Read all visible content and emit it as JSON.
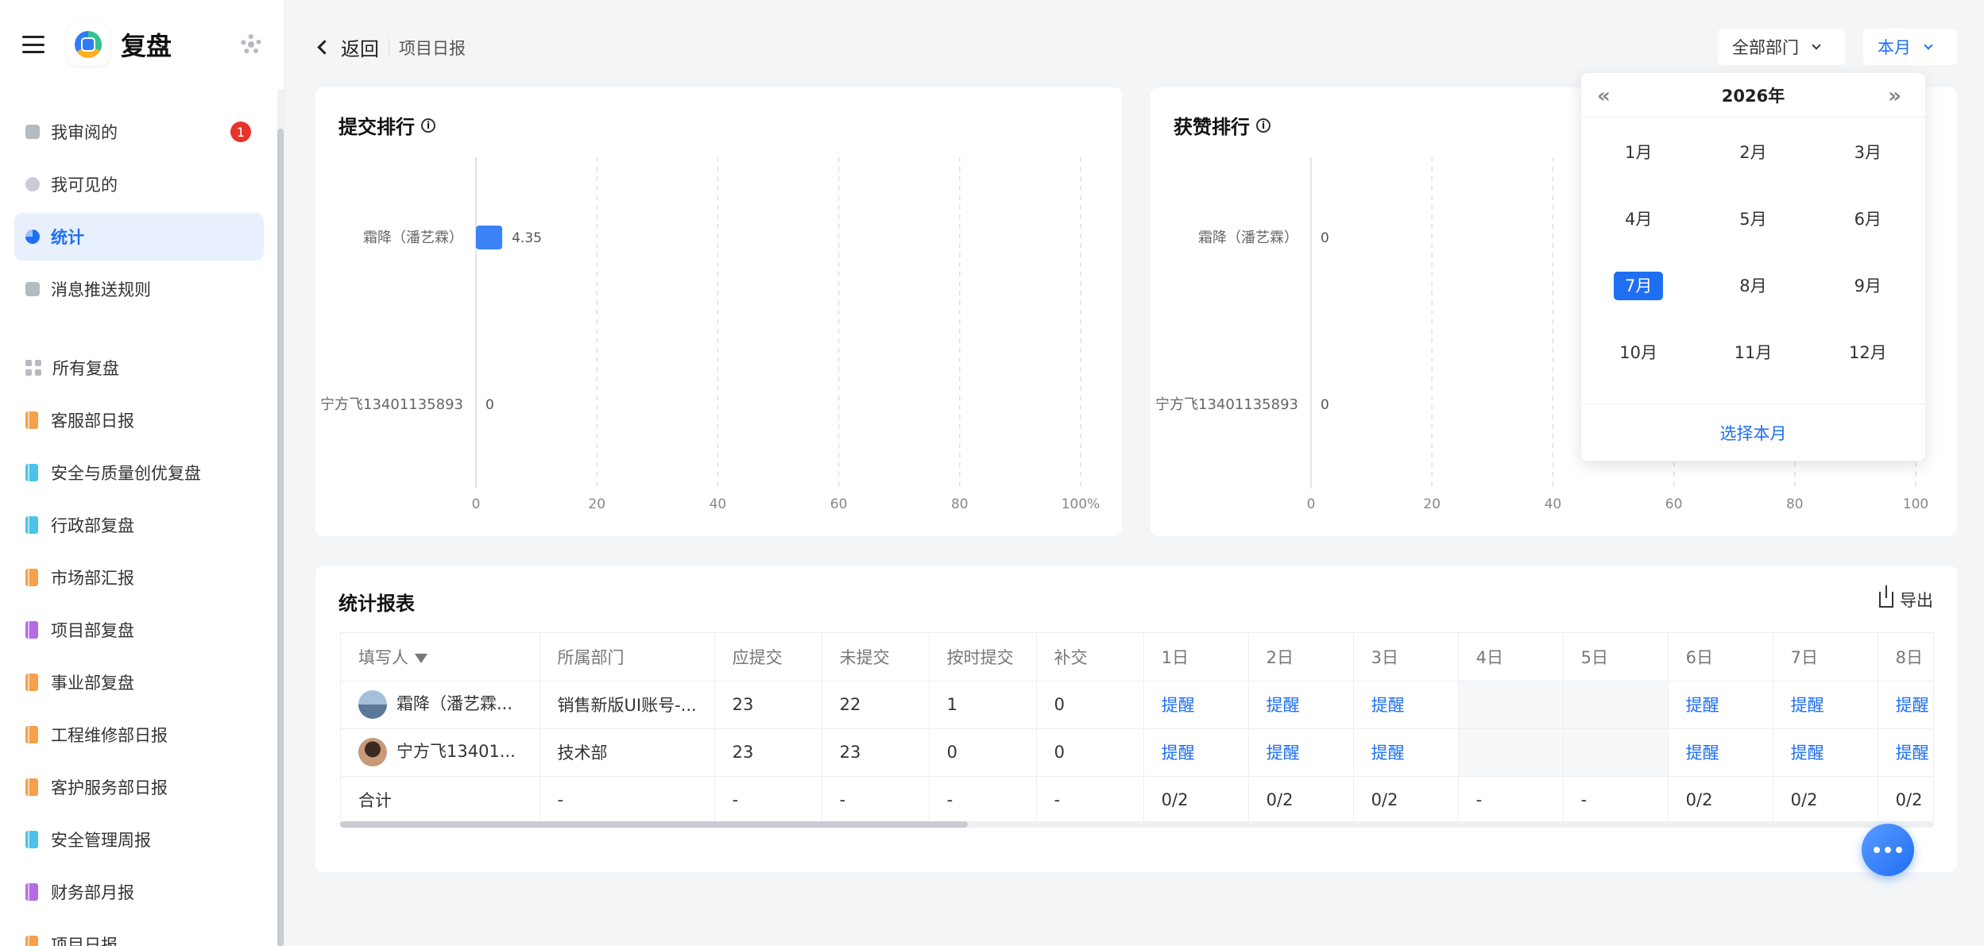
{
  "app": {
    "name": "复盘"
  },
  "sidebar": {
    "nav": [
      {
        "label": "我审阅的",
        "badge": "1"
      },
      {
        "label": "我可见的"
      },
      {
        "label": "统计"
      },
      {
        "label": "消息推送规则"
      }
    ],
    "groups_title": "所有复盘",
    "groups": [
      {
        "label": "客服部日报",
        "color": "orange"
      },
      {
        "label": "安全与质量创优复盘",
        "color": "cyan"
      },
      {
        "label": "行政部复盘",
        "color": "cyan"
      },
      {
        "label": "市场部汇报",
        "color": "orange"
      },
      {
        "label": "项目部复盘",
        "color": "purple"
      },
      {
        "label": "事业部复盘",
        "color": "orange"
      },
      {
        "label": "工程维修部日报",
        "color": "orange"
      },
      {
        "label": "客护服务部日报",
        "color": "orange"
      },
      {
        "label": "安全管理周报",
        "color": "cyan"
      },
      {
        "label": "财务部月报",
        "color": "purple"
      },
      {
        "label": "项目日报",
        "color": "orange"
      }
    ]
  },
  "header": {
    "back_label": "返回",
    "breadcrumb": "项目日报",
    "dept_filter": "全部部门",
    "period_filter": "本月"
  },
  "calendar": {
    "year": "2026年",
    "prev": "«",
    "next": "»",
    "months": [
      "1月",
      "2月",
      "3月",
      "4月",
      "5月",
      "6月",
      "7月",
      "8月",
      "9月",
      "10月",
      "11月",
      "12月"
    ],
    "selected": "7月",
    "footer": "选择本月"
  },
  "chart_data": [
    {
      "type": "bar",
      "title": "提交排行",
      "orientation": "horizontal",
      "categories": [
        "霜降（潘艺霖）",
        "宁方飞13401135893"
      ],
      "values": [
        4.35,
        0
      ],
      "value_labels": [
        "4.35",
        "0"
      ],
      "xlim": [
        0,
        100
      ],
      "xticks": [
        "0",
        "20",
        "40",
        "60",
        "80",
        "100%"
      ],
      "color": "#3b82f6",
      "grid": "vertical dashed"
    },
    {
      "type": "bar",
      "title": "获赞排行",
      "orientation": "horizontal",
      "categories": [
        "霜降（潘艺霖）",
        "宁方飞13401135893"
      ],
      "values": [
        0,
        0
      ],
      "value_labels": [
        "0",
        "0"
      ],
      "xlim": [
        0,
        100
      ],
      "xticks": [
        "0",
        "20",
        "40",
        "60",
        "80",
        "100"
      ],
      "color": "#3b82f6",
      "grid": "vertical dashed"
    }
  ],
  "report": {
    "title": "统计报表",
    "export": "导出",
    "columns": [
      "填写人",
      "所属部门",
      "应提交",
      "未提交",
      "按时提交",
      "补交",
      "1日",
      "2日",
      "3日",
      "4日",
      "5日",
      "6日",
      "7日",
      "8日"
    ],
    "rows": [
      {
        "name": "霜降（潘艺霖...",
        "dept": "销售新版UI账号-...",
        "should": "23",
        "missing": "22",
        "ontime": "1",
        "late": "0",
        "days": [
          "提醒",
          "提醒",
          "提醒",
          "",
          "",
          "提醒",
          "提醒",
          "提醒"
        ]
      },
      {
        "name": "宁方飞13401...",
        "dept": "技术部",
        "should": "23",
        "missing": "23",
        "ontime": "0",
        "late": "0",
        "days": [
          "提醒",
          "提醒",
          "提醒",
          "",
          "",
          "提醒",
          "提醒",
          "提醒"
        ]
      }
    ],
    "total": {
      "label": "合计",
      "dept": "-",
      "should": "-",
      "missing": "-",
      "ontime": "-",
      "late": "-",
      "days": [
        "0/2",
        "0/2",
        "0/2",
        "-",
        "-",
        "0/2",
        "0/2",
        "0/2"
      ]
    }
  }
}
